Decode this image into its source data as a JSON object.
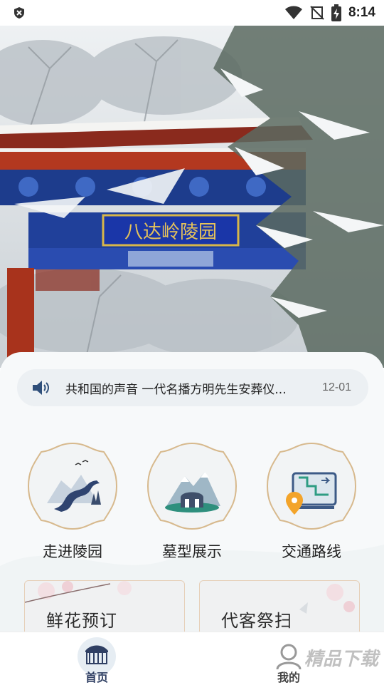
{
  "status_bar": {
    "time": "8:14"
  },
  "banner": {
    "gate_sign": "八达岭陵园",
    "slides": 7,
    "active_slide": 0
  },
  "notice": {
    "text": "共和国的声音 一代名播方明先生安葬仪...",
    "date": "12-01"
  },
  "features": [
    {
      "label": "走进陵园",
      "icon": "winding-road-mountain-icon"
    },
    {
      "label": "墓型展示",
      "icon": "tomb-mountain-icon"
    },
    {
      "label": "交通路线",
      "icon": "map-location-icon"
    }
  ],
  "cards": [
    {
      "title": "鲜花预订"
    },
    {
      "title": "代客祭扫"
    }
  ],
  "tabbar": {
    "tabs": [
      {
        "label": "首页",
        "icon": "memorial-gate-icon",
        "active": true
      },
      {
        "label": "我的",
        "icon": "user-icon",
        "active": false
      }
    ],
    "active_color": "#2f3f63"
  },
  "watermark": "精品下载"
}
